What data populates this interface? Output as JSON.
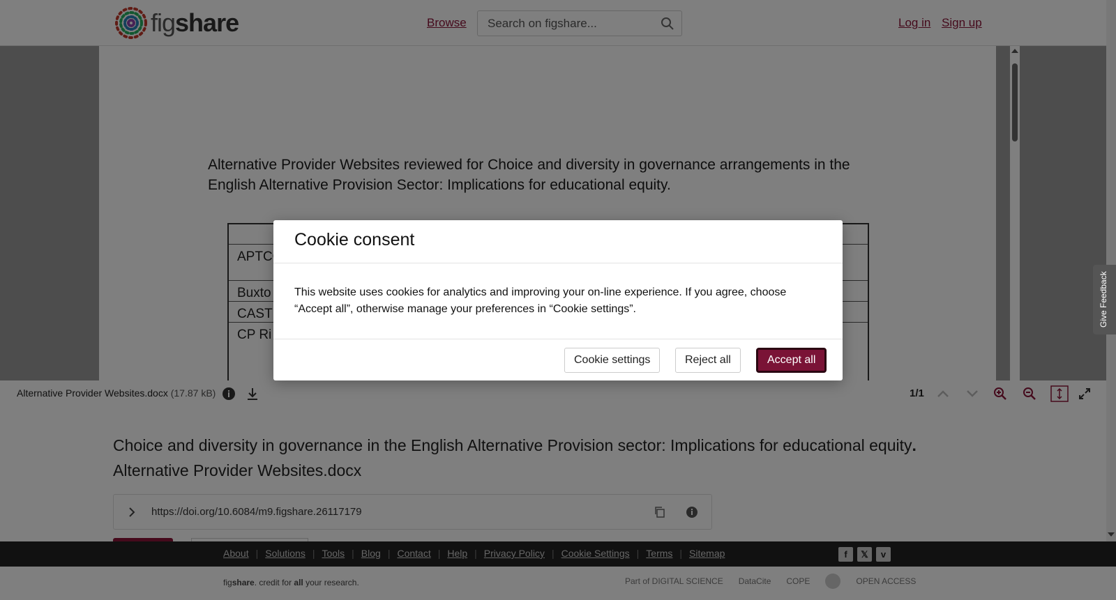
{
  "header": {
    "logo_text_light": "fig",
    "logo_text_bold": "share",
    "browse_label": "Browse",
    "search_placeholder": "Search on figshare...",
    "login_label": "Log in",
    "signup_label": "Sign up"
  },
  "document": {
    "title_line1": "Alternative Provider Websites reviewed for Choice and diversity in governance arrangements in the",
    "title_line2": "English Alternative Provision Sector: Implications for educational equity.",
    "table_cells": [
      "APTCO",
      "Buxto",
      "CAST",
      "CP Ri"
    ]
  },
  "toolbar": {
    "file_name": "Alternative Provider Websites.docx",
    "file_size": "(17.87 kB)",
    "page_count": "1/1"
  },
  "item": {
    "title": "Choice and diversity in governance in the English Alternative Provision sector: Implications for educational equity",
    "title_end": ".",
    "file_name": "Alternative Provider Websites.docx",
    "doi": "https://doi.org/10.6084/m9.figshare.26117179"
  },
  "footer": {
    "links": [
      "About",
      "Solutions",
      "Tools",
      "Blog",
      "Contact",
      "Help",
      "Privacy Policy",
      "Cookie Settings",
      "Terms",
      "Sitemap"
    ],
    "credit_prefix": "fig",
    "credit_bold": "share",
    "credit_mid": ". credit for ",
    "credit_all": "all",
    "credit_suffix": " your research.",
    "partners": [
      "Part of DIGITAL SCIENCE",
      "DataCite",
      "COPE",
      "",
      "OPEN ACCESS"
    ],
    "social_icons": [
      "facebook-icon",
      "x-icon",
      "vimeo-icon"
    ]
  },
  "feedback_label": "Give Feedback",
  "modal": {
    "title": "Cookie consent",
    "body": "This website uses cookies for analytics and improving your on-line experience. If you agree, choose “Accept all”, otherwise manage your preferences in “Cookie settings”.",
    "settings_label": "Cookie settings",
    "reject_label": "Reject all",
    "accept_label": "Accept all"
  },
  "colors": {
    "brand": "#8a1538",
    "accept_button": "#7a1336"
  }
}
